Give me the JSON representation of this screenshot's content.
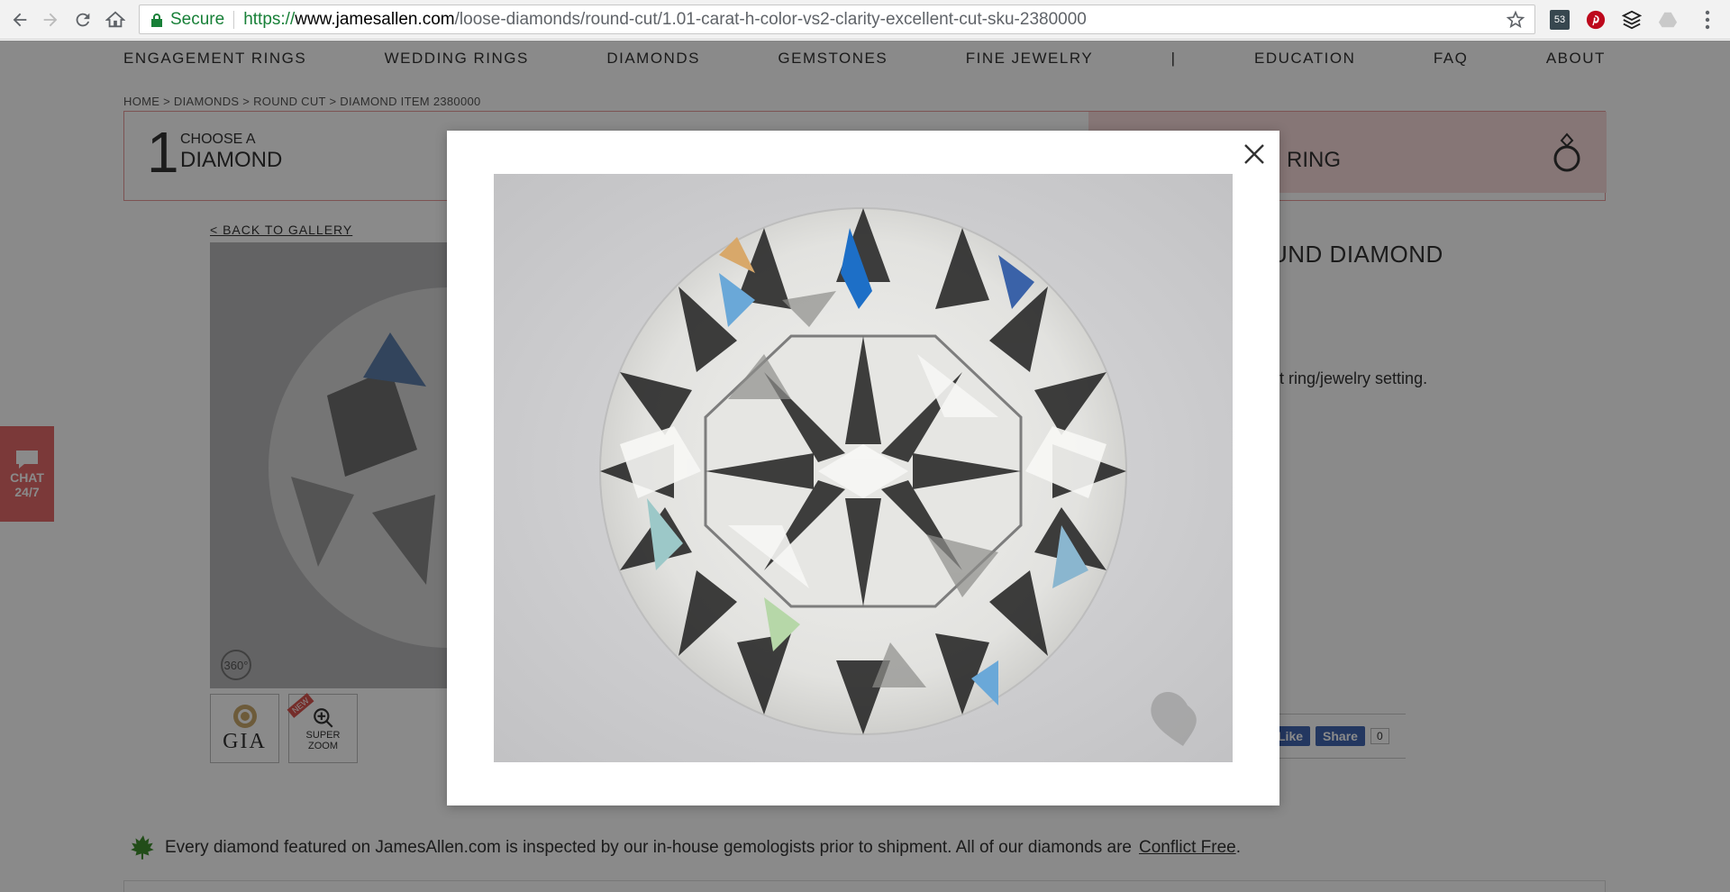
{
  "browser": {
    "secure_label": "Secure",
    "url_scheme": "https://",
    "url_host": "www.jamesallen.com",
    "url_path": "/loose-diamonds/round-cut/1.01-carat-h-color-vs2-clarity-excellent-cut-sku-2380000",
    "extension_badge": "53"
  },
  "nav": {
    "items": [
      "ENGAGEMENT RINGS",
      "WEDDING RINGS",
      "DIAMONDS",
      "GEMSTONES",
      "FINE JEWELRY",
      "|",
      "EDUCATION",
      "FAQ",
      "ABOUT"
    ]
  },
  "breadcrumb": "HOME > DIAMONDS > ROUND CUT > DIAMOND ITEM 2380000",
  "steps": {
    "step1_number": "1",
    "step1_line1": "CHOOSE A",
    "step1_line2": "DIAMOND",
    "step3_label": "RING"
  },
  "gallery": {
    "back_link": "< BACK TO GALLERY",
    "badge_360": "360°",
    "gia_label": "GIA",
    "new_label": "NEW",
    "super_zoom_line1": "SUPER",
    "super_zoom_line2": "ZOOM"
  },
  "chat": {
    "line1": "CHAT",
    "line2": "24/7"
  },
  "product": {
    "title_fragment": "UND DIAMOND",
    "text_fragment": "nt ring/jewelry setting."
  },
  "social": {
    "like": "Like",
    "share": "Share",
    "count": "0"
  },
  "footer": {
    "note": "Every diamond featured on JamesAllen.com is inspected by our in-house gemologists prior to shipment. All of our diamonds are",
    "link": "Conflict Free",
    "period": "."
  },
  "colors": {
    "accent_pink": "#e36a6a",
    "secure_green": "#188038",
    "facebook_blue": "#4267b2"
  }
}
